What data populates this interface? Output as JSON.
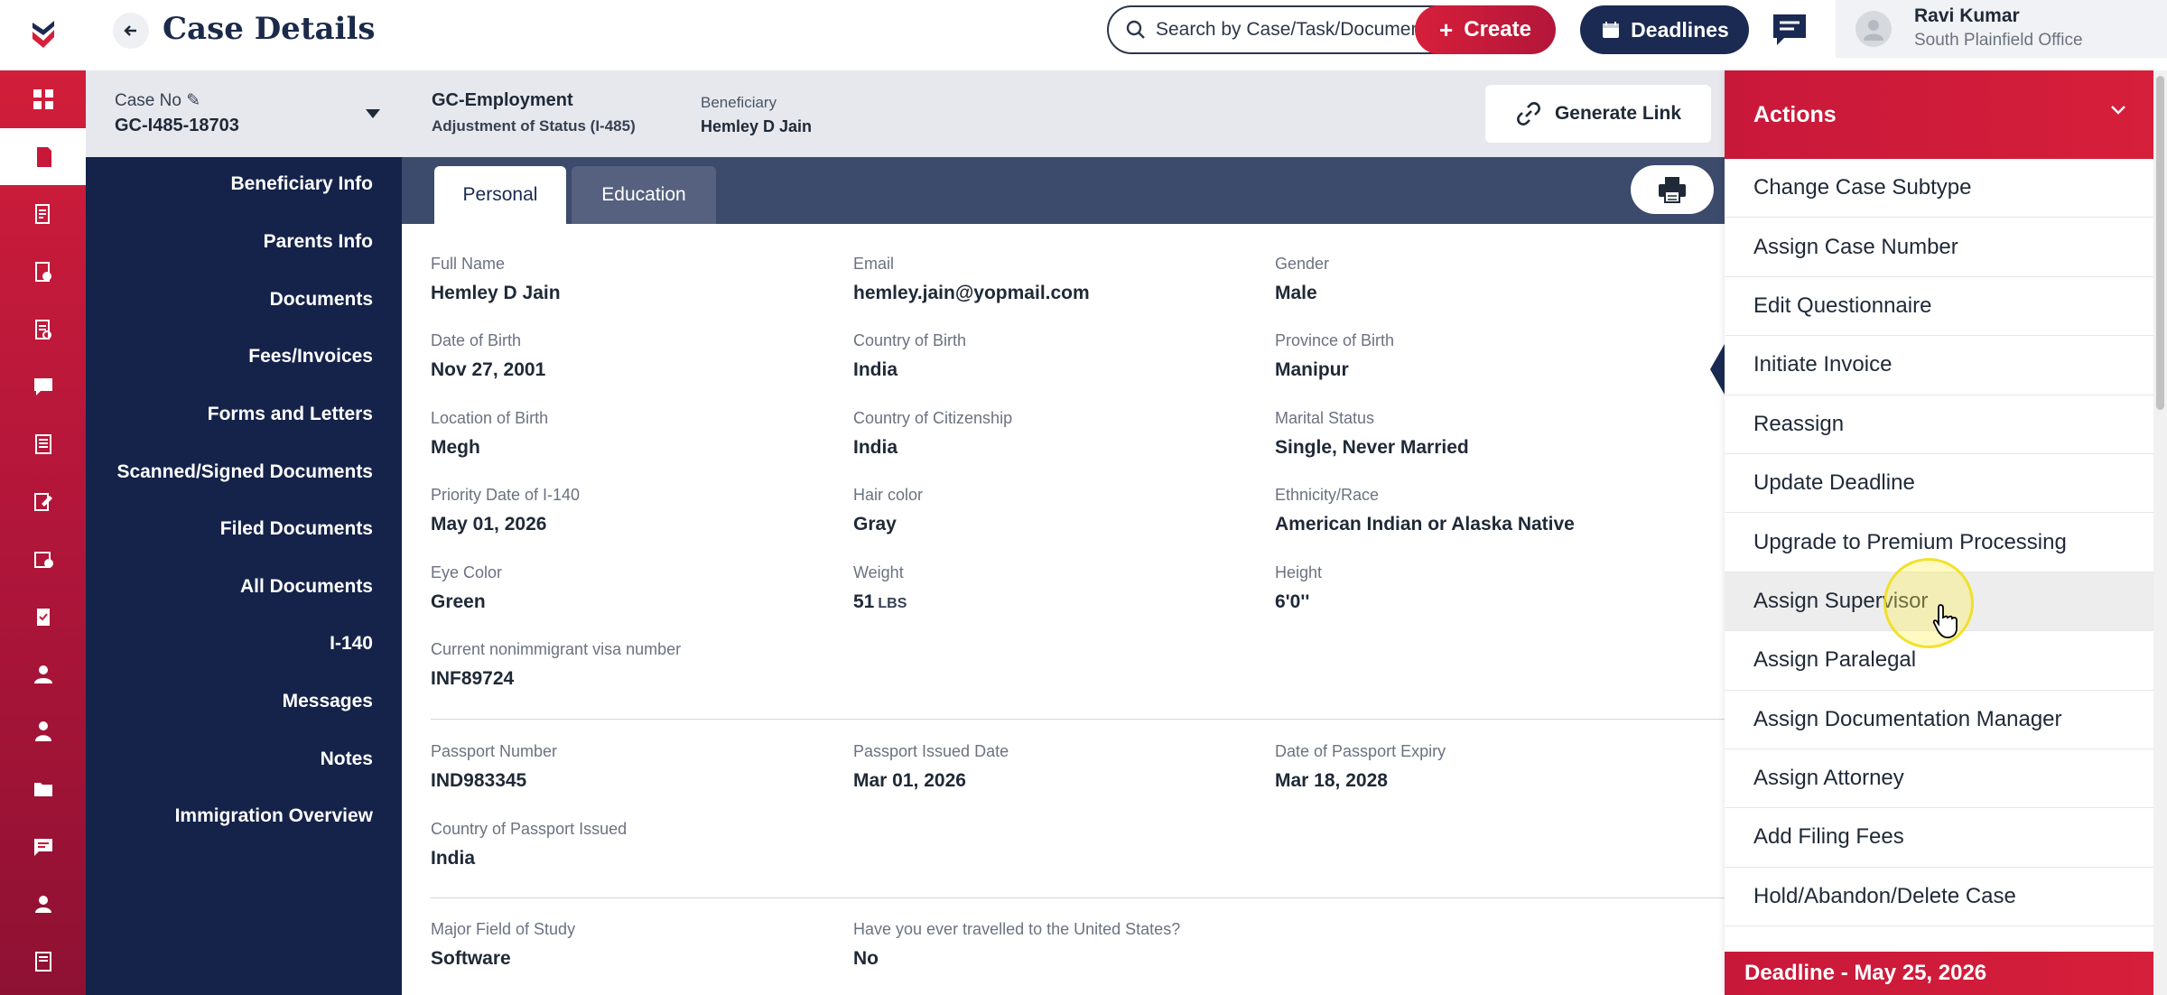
{
  "header": {
    "title": "Case Details",
    "search_placeholder": "Search by Case/Task/Document",
    "create_label": "Create",
    "deadlines_label": "Deadlines",
    "user_name": "Ravi Kumar",
    "user_office": "South Plainfield Office"
  },
  "case": {
    "case_no_label": "Case No",
    "case_no": "GC-I485-18703",
    "type": "GC-Employment",
    "subtype": "Adjustment of Status (I-485)",
    "beneficiary_label": "Beneficiary",
    "beneficiary": "Hemley D Jain",
    "generate_link_label": "Generate Link"
  },
  "section_nav": [
    "Beneficiary Info",
    "Parents Info",
    "Documents",
    "Fees/Invoices",
    "Forms and Letters",
    "Scanned/Signed Documents",
    "Filed Documents",
    "All Documents",
    "I-140",
    "Messages",
    "Notes",
    "Immigration Overview"
  ],
  "tabs": [
    "Personal",
    "Education"
  ],
  "fields": {
    "full_name": {
      "label": "Full Name",
      "value": "Hemley D Jain"
    },
    "email": {
      "label": "Email",
      "value": "hemley.jain@yopmail.com"
    },
    "gender": {
      "label": "Gender",
      "value": "Male"
    },
    "dob": {
      "label": "Date of Birth",
      "value": "Nov 27, 2001"
    },
    "country_birth": {
      "label": "Country of Birth",
      "value": "India"
    },
    "province_birth": {
      "label": "Province of Birth",
      "value": "Manipur"
    },
    "location_birth": {
      "label": "Location of Birth",
      "value": "Megh"
    },
    "citizenship": {
      "label": "Country of Citizenship",
      "value": "India"
    },
    "marital": {
      "label": "Marital Status",
      "value": "Single, Never Married"
    },
    "priority_date": {
      "label": "Priority Date of I-140",
      "value": "May 01, 2026"
    },
    "hair": {
      "label": "Hair color",
      "value": "Gray"
    },
    "ethnicity": {
      "label": "Ethnicity/Race",
      "value": "American Indian or Alaska Native"
    },
    "eye": {
      "label": "Eye Color",
      "value": "Green"
    },
    "weight": {
      "label": "Weight",
      "value": "51",
      "unit": "LBS"
    },
    "height": {
      "label": "Height",
      "value": "6'0''"
    },
    "visa_number": {
      "label": "Current nonimmigrant visa number",
      "value": "INF89724"
    },
    "passport_number": {
      "label": "Passport Number",
      "value": "IND983345"
    },
    "passport_issued": {
      "label": "Passport Issued Date",
      "value": "Mar 01, 2026"
    },
    "passport_expiry": {
      "label": "Date of Passport Expiry",
      "value": "Mar 18, 2028"
    },
    "passport_country": {
      "label": "Country of Passport Issued",
      "value": "India"
    },
    "major": {
      "label": "Major Field of Study",
      "value": "Software"
    },
    "travelled_us": {
      "label": "Have you ever travelled to the United States?",
      "value": "No"
    }
  },
  "actions": {
    "title": "Actions",
    "items": [
      "Change Case Subtype",
      "Assign Case Number",
      "Edit Questionnaire",
      "Initiate Invoice",
      "Reassign",
      "Update Deadline",
      "Upgrade to Premium Processing",
      "Assign Supervisor",
      "Assign Paralegal",
      "Assign Documentation Manager",
      "Assign Attorney",
      "Add Filing Fees",
      "Hold/Abandon/Delete Case"
    ],
    "deadline": "Deadline - May 25, 2026"
  },
  "colors": {
    "brand_red": "#d61f3a",
    "navy": "#15234a",
    "tab_bar": "#3c4a6b"
  },
  "icons": {
    "rail": [
      "dashboard-icon",
      "cases-icon",
      "tasks-icon",
      "forms-icon",
      "documents-icon",
      "messages-icon",
      "reports-icon",
      "notes-icon",
      "billing-icon",
      "clipboard-icon",
      "user-icon",
      "team-icon",
      "folder-icon",
      "chat-icon",
      "profile-icon",
      "book-icon"
    ]
  }
}
